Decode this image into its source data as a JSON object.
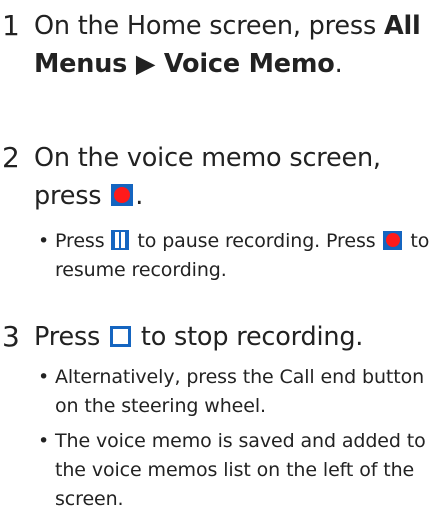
{
  "steps": [
    {
      "number": "1",
      "text_before": "On the Home screen, press ",
      "bold": "All Menus ▶ Voice Memo",
      "text_after": "."
    },
    {
      "number": "2",
      "text_before": "On the voice memo screen, press ",
      "icon": "record-icon",
      "text_after": ".",
      "bullets": [
        {
          "before": "Press ",
          "icon1": "pause-icon",
          "middle": " to pause recording. Press ",
          "icon2": "record-icon",
          "after": " to resume recording."
        }
      ]
    },
    {
      "number": "3",
      "text_before": "Press ",
      "icon": "stop-icon",
      "text_after": " to stop recording.",
      "bullets": [
        {
          "text": "Alternatively, press the Call end button on the steering wheel."
        },
        {
          "text": "The voice memo is saved and added to the voice memos list on the left of the screen."
        }
      ]
    }
  ],
  "colors": {
    "icon_background": "#1565c0",
    "record_dot": "#ff1a1a",
    "text": "#222222"
  }
}
